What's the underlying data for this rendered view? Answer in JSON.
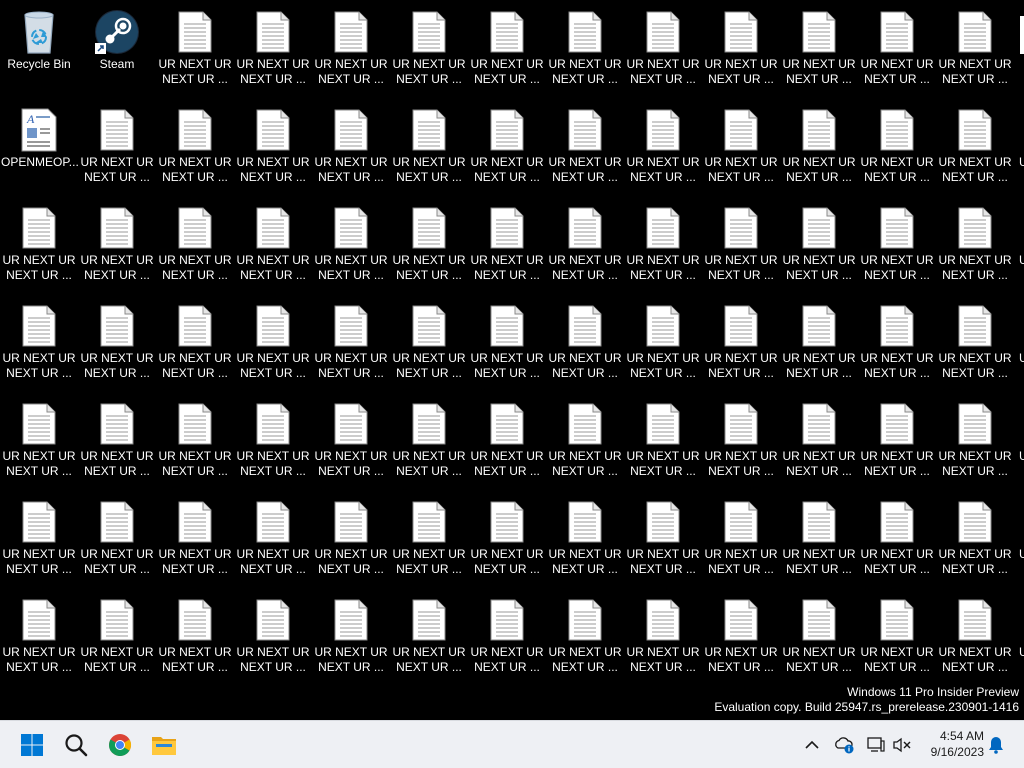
{
  "desktop": {
    "system_icons": [
      {
        "label": "Recycle Bin",
        "icon": "recycle-bin-icon"
      },
      {
        "label": "Steam",
        "icon": "steam-icon"
      },
      {
        "label": "OPENMEOP...",
        "icon": "document-icon"
      }
    ],
    "file_label_line1": "UR NEXT UR",
    "file_label_line2": "NEXT UR ...",
    "file_icon": "text-file-icon",
    "partial_label": "U"
  },
  "watermark": {
    "line1": "Windows 11 Pro Insider Preview",
    "line2": "Evaluation copy. Build 25947.rs_prerelease.230901-1416"
  },
  "taskbar": {
    "apps": [
      {
        "name": "start-button",
        "icon": "windows-logo-icon"
      },
      {
        "name": "search-button",
        "icon": "search-icon"
      },
      {
        "name": "chrome-button",
        "icon": "chrome-icon"
      },
      {
        "name": "file-explorer-button",
        "icon": "folder-icon"
      }
    ],
    "tray": [
      {
        "name": "show-hidden-icons-button",
        "icon": "chevron-up-icon"
      },
      {
        "name": "network-info-icon",
        "icon": "cloud-info-icon"
      },
      {
        "name": "network-icon",
        "icon": "network-icon"
      },
      {
        "name": "volume-muted-icon",
        "icon": "speaker-muted-icon"
      }
    ],
    "time": "4:54 AM",
    "date": "9/16/2023",
    "notification_icon": "bell-icon"
  },
  "colors": {
    "desktop_bg": "#000000",
    "taskbar_bg": "#eef0f4",
    "accent_blue": "#0067c0"
  }
}
